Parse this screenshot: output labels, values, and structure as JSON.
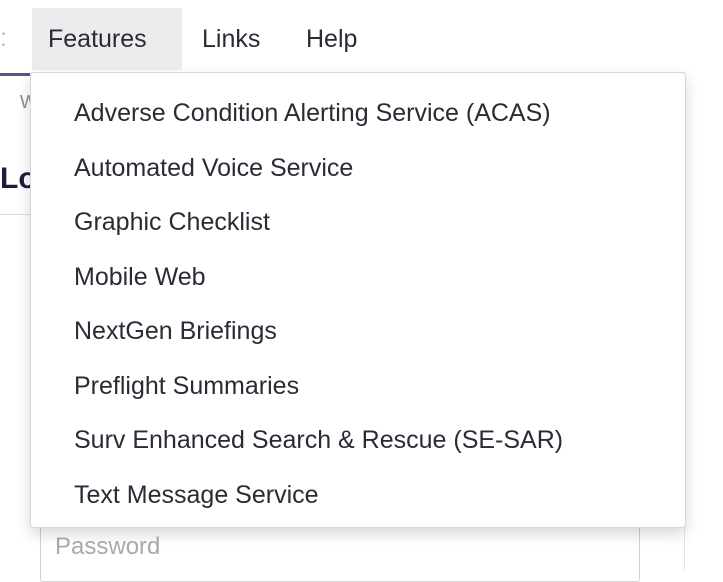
{
  "navbar": {
    "items": [
      {
        "label": "Features",
        "active": true
      },
      {
        "label": "Links",
        "active": false
      },
      {
        "label": "Help",
        "active": false
      }
    ]
  },
  "features_menu": {
    "items": [
      "Adverse Condition Alerting Service (ACAS)",
      "Automated Voice Service",
      "Graphic Checklist",
      "Mobile Web",
      "NextGen Briefings",
      "Preflight Summaries",
      "Surv Enhanced Search & Rescue (SE-SAR)",
      "Text Message Service"
    ]
  },
  "background": {
    "fragment_left_nav": ":",
    "fragment_w": "W",
    "fragment_heading": "Lo"
  },
  "password_field": {
    "placeholder": "Password",
    "value": ""
  },
  "colors": {
    "text": "#2b2b36",
    "active_nav_bg": "#ececef",
    "accent": "#5b5478",
    "heading": "#1f1b3a"
  }
}
